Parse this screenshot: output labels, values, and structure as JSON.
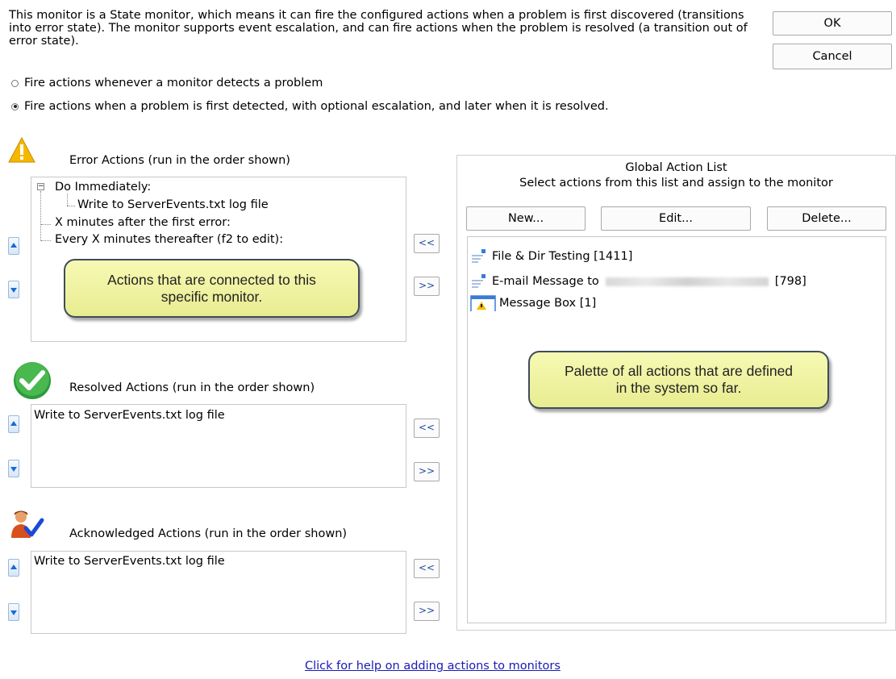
{
  "description": "This monitor is a State monitor, which means it can fire the configured actions when a problem is first discovered (transitions into error state).  The monitor supports event escalation, and can fire actions when the problem is resolved (a transition out of error state).",
  "dialog_buttons": {
    "ok": "OK",
    "cancel": "Cancel"
  },
  "fire_options": [
    {
      "label": "Fire actions whenever a monitor detects a problem",
      "checked": false
    },
    {
      "label": "Fire actions when a problem is first detected, with optional escalation, and later when it is resolved.",
      "checked": true
    }
  ],
  "error_actions": {
    "title": "Error Actions (run in the order shown)",
    "tree": {
      "root": "Do Immediately:",
      "child": "Write to ServerEvents.txt log file",
      "after_first": "X minutes after the first error:",
      "every": "Every X minutes thereafter (f2 to edit):"
    },
    "callout": "Actions that are connected to this specific monitor."
  },
  "resolved_actions": {
    "title": "Resolved Actions (run in the order shown)",
    "items": [
      "Write to ServerEvents.txt log file"
    ]
  },
  "acknowledged_actions": {
    "title": "Acknowledged Actions (run in the order shown)",
    "items": [
      "Write to ServerEvents.txt log file"
    ]
  },
  "move_buttons": {
    "add": "<<",
    "remove": ">>"
  },
  "global_list": {
    "title": "Global Action List",
    "subtitle": "Select actions from this list and assign to the monitor",
    "buttons": {
      "new": "New...",
      "edit": "Edit...",
      "delete": "Delete..."
    },
    "items": [
      {
        "label": "File & Dir Testing [1411]",
        "icon": "document-icon"
      },
      {
        "label": "E-mail Message to",
        "suffix": "[798]",
        "icon": "document-icon"
      },
      {
        "label": "Message Box [1]",
        "icon": "warning-window-icon"
      }
    ],
    "callout": "Palette of all actions that are defined in the system so far."
  },
  "help_link": "Click for help on adding actions to monitors",
  "colors": {
    "callout_fill": "#eef2a0",
    "link": "#1a1ab5",
    "arrow": "#1a6ad0"
  }
}
